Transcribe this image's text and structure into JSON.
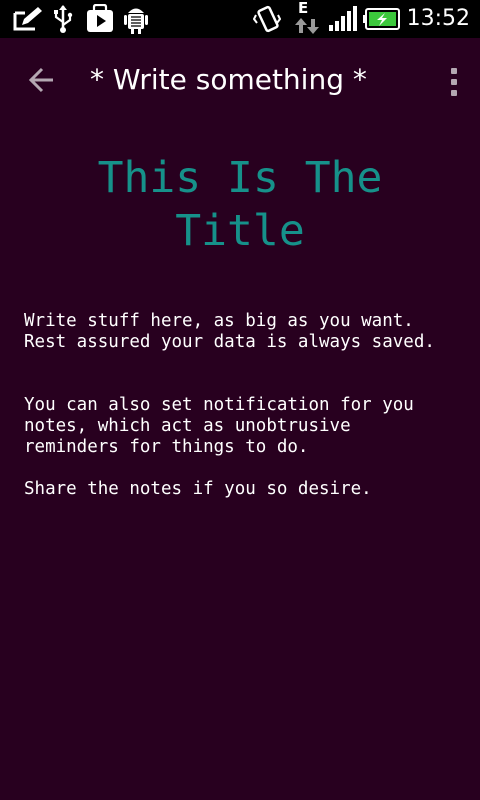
{
  "status_bar": {
    "time": "13:52",
    "network_type": "E",
    "battery_color": "#3cc83c",
    "icons": [
      "compose-notification-icon",
      "usb-icon",
      "play-store-icon",
      "android-debug-icon",
      "vibrate-icon",
      "data-arrows-icon",
      "signal-icon",
      "battery-charging-icon"
    ]
  },
  "action_bar": {
    "title": "* Write something *",
    "back_icon": "arrow-left-icon",
    "overflow_icon": "vertical-dots-icon"
  },
  "note": {
    "title_color": "#16918a",
    "title_lines": [
      "This Is The",
      "Title"
    ],
    "body_lines": [
      "Write stuff here, as big as you want.",
      "Rest assured your data is always saved.",
      "You can also set notification for you",
      "notes, which act as unobtrusive",
      "reminders for things to do.",
      "Share the notes if you so desire."
    ]
  }
}
